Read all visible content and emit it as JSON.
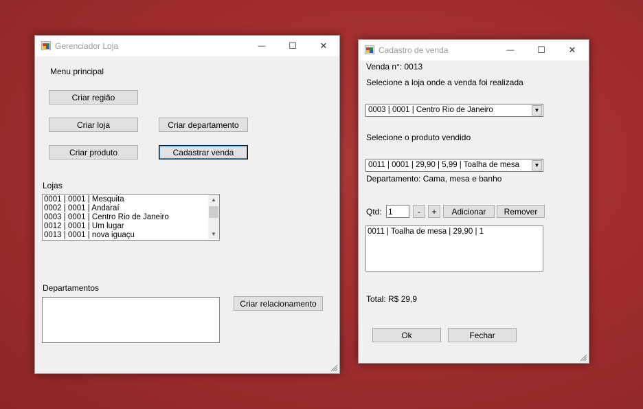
{
  "gerenciador": {
    "title": "Gerenciador Loja",
    "menu_label": "Menu principal",
    "buttons": {
      "criar_regiao": "Criar região",
      "criar_loja": "Criar loja",
      "criar_departamento": "Criar departamento",
      "criar_produto": "Criar produto",
      "cadastrar_venda": "Cadastrar venda",
      "criar_relacionamento": "Criar relacionamento"
    },
    "lojas_label": "Lojas",
    "lojas_items": [
      "0001 | 0001 | Mesquita",
      "0002 | 0001 | Andaraí",
      "0003 | 0001 | Centro Rio de Janeiro",
      "0012 | 0001 | Um lugar",
      "0013 | 0001 | nova iguaçu"
    ],
    "departamentos_label": "Departamentos",
    "departamentos_items": []
  },
  "cadastro": {
    "title": "Cadastro de venda",
    "venda_numero": "Venda n°: 0013",
    "loja_prompt": "Selecione a loja onde a venda foi realizada",
    "loja_selected": "0003 | 0001 | Centro Rio de Janeiro",
    "produto_prompt": "Selecione o produto vendido",
    "produto_selected": "0011 | 0001 | 29,90 | 5,99 | Toalha de mesa",
    "departamento_text": "Departamento: Cama, mesa e banho",
    "qtd_label": "Qtd:",
    "qtd_value": "1",
    "minus_label": "-",
    "plus_label": "+",
    "adicionar_label": "Adicionar",
    "remover_label": "Remover",
    "itens": [
      "0011 | Toalha de mesa | 29,90 | 1"
    ],
    "total": "Total: R$ 29,9",
    "ok_label": "Ok",
    "fechar_label": "Fechar"
  },
  "window_controls": {
    "minimize": "—",
    "maximize": "☐",
    "close": "✕"
  }
}
